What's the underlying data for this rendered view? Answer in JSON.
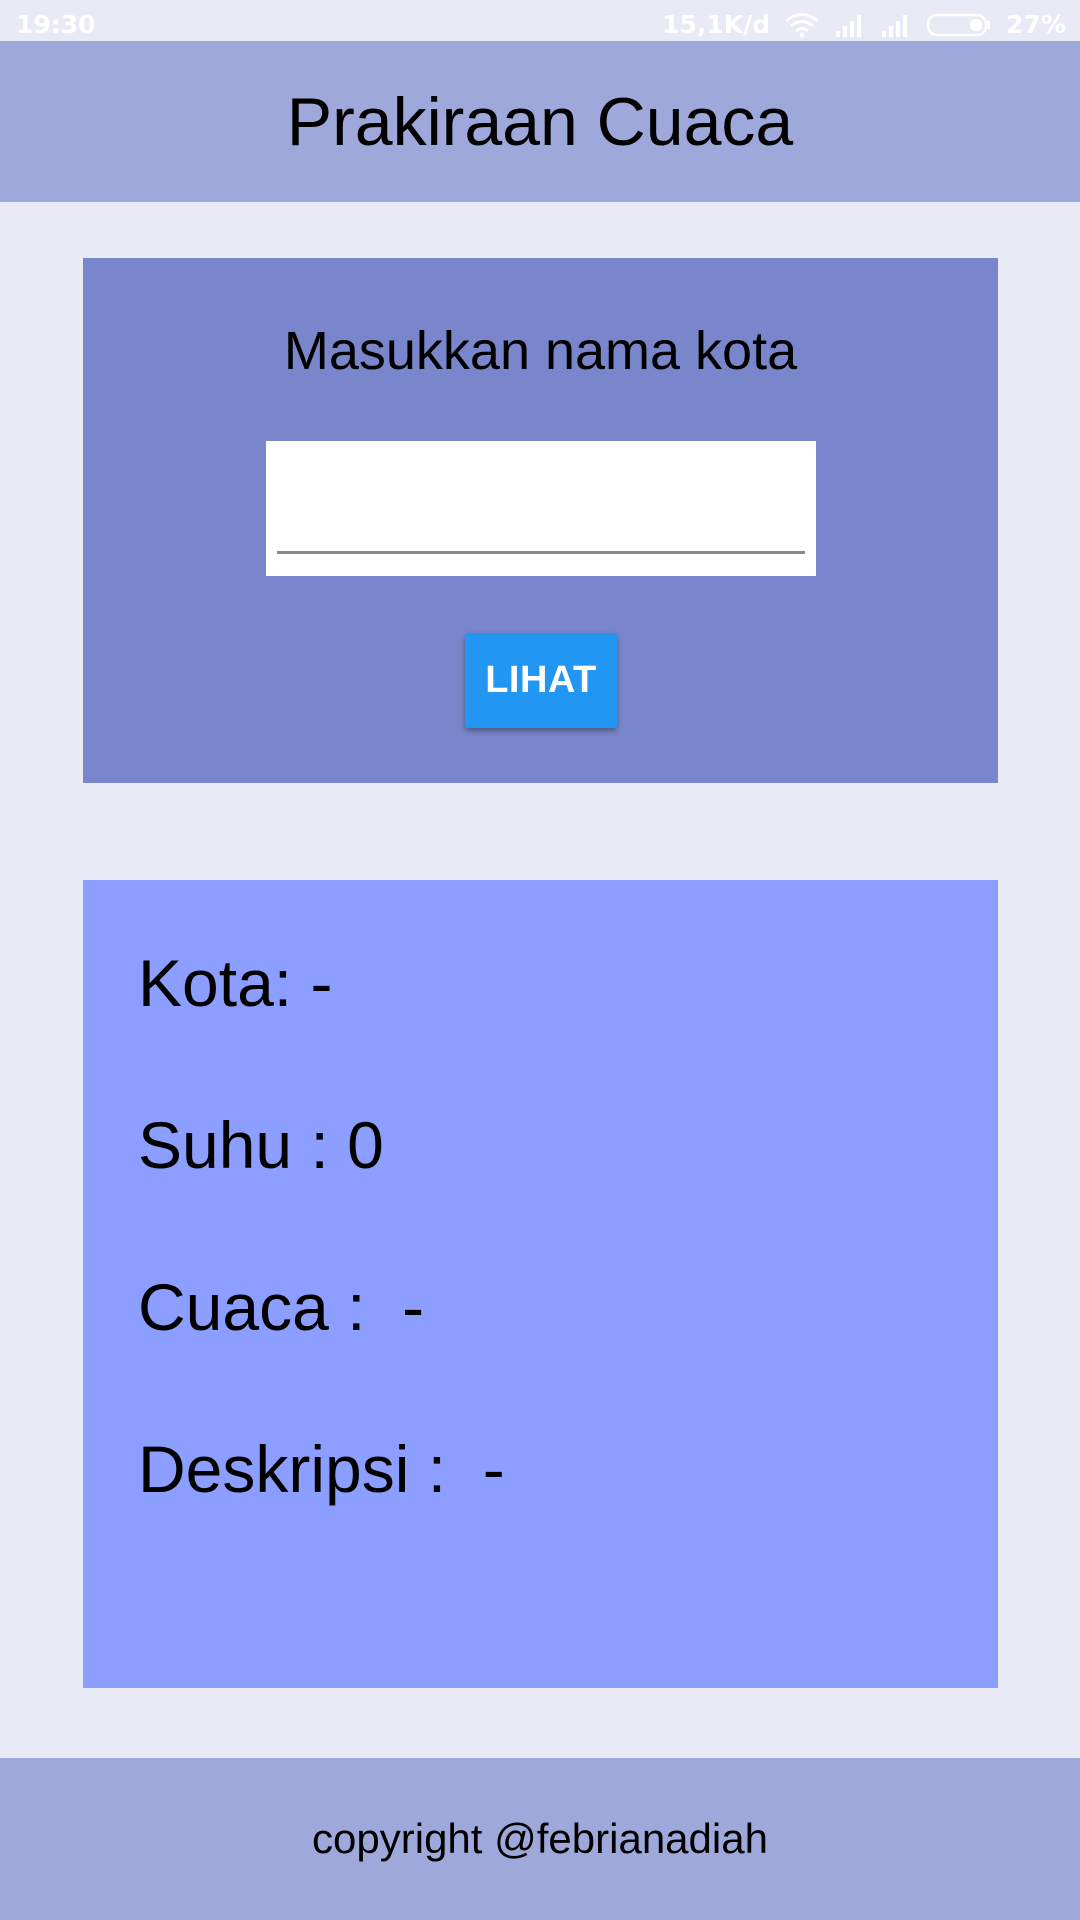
{
  "status_bar": {
    "time": "19:30",
    "speed": "15,1K/d",
    "battery": "27%",
    "icons": [
      "wifi-icon",
      "signal-icon",
      "signal-icon",
      "battery-icon"
    ]
  },
  "app_bar": {
    "title": "Prakiraan Cuaca"
  },
  "search": {
    "label": "Masukkan nama kota",
    "value": "",
    "button_label": "LIHAT"
  },
  "result": {
    "kota": "Kota: -",
    "suhu": "Suhu : 0",
    "cuaca": "Cuaca :  -",
    "deskripsi": "Deskripsi :  -"
  },
  "footer": {
    "text": "copyright @febrianadiah"
  },
  "colors": {
    "background": "#e8eaf6",
    "app_bar": "#9fa8da",
    "search_card": "#7986cb",
    "result_card": "#8c9eff",
    "button": "#2196f3"
  }
}
